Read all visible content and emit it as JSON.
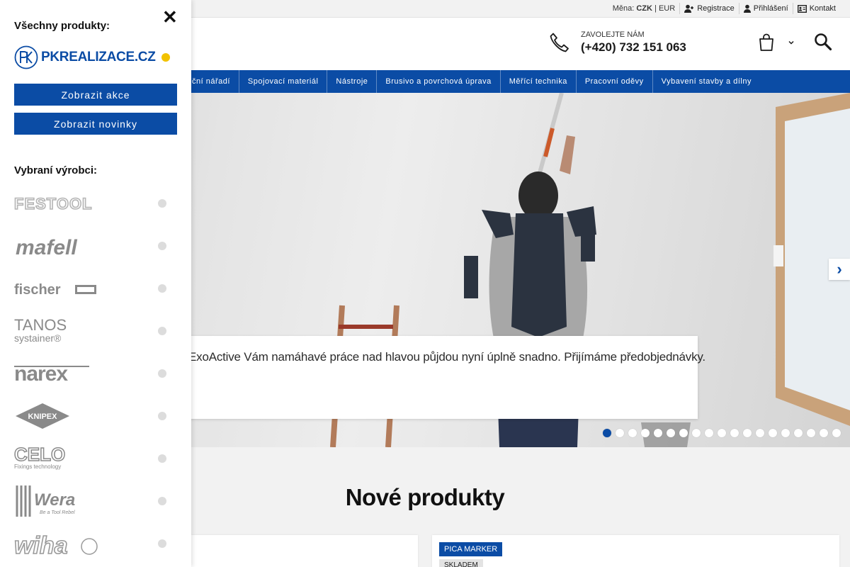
{
  "topbar": {
    "currency_label": "Měna:",
    "currency_active": "CZK",
    "currency_sep": "|",
    "currency_other": "EUR",
    "register_label": "Registrace",
    "login_label": "Přihlášení",
    "contact_label": "Kontakt"
  },
  "header": {
    "phone_caption": "ZAVOLEJTE NÁM",
    "phone_number": "(+420) 732 151 063"
  },
  "nav": {
    "items": [
      "ční nářadí",
      "Spojovací materiál",
      "Nástroje",
      "Brusivo a povrchová úprava",
      "Měřící technika",
      "Pracovní oděvy",
      "Vybavení stavby a dílny"
    ]
  },
  "hero": {
    "caption": "ExoActive Vám namáhavé práce nad hlavou půjdou nyní úplně snadno. Přijímáme předobjednávky.",
    "next_symbol": "›",
    "slide_count": 19,
    "active_slide": 1
  },
  "main": {
    "section_title": "Nové produkty",
    "card_right": {
      "brand_badge": "PICA MARKER",
      "stock_badge": "SKLADEM"
    }
  },
  "sidebar": {
    "title": "Všechny produkty:",
    "close_symbol": "✕",
    "logo_text": "PKREALIZACE.CZ",
    "logo_mark": "PK",
    "btn_akce": "Zobrazit akce",
    "btn_novinky": "Zobrazit novinky",
    "brands_title": "Vybraní výrobci:",
    "brands": [
      {
        "name": "FESTOOL",
        "icon": "festool-logo"
      },
      {
        "name": "mafell",
        "icon": "mafell-logo"
      },
      {
        "name": "fischer",
        "icon": "fischer-logo"
      },
      {
        "name": "TANOS",
        "sub": "systainer®",
        "icon": "tanos-logo"
      },
      {
        "name": "narex",
        "icon": "narex-logo"
      },
      {
        "name": "KNIPEX",
        "icon": "knipex-logo"
      },
      {
        "name": "CELO",
        "sub": "Fixings technology",
        "icon": "celo-logo"
      },
      {
        "name": "Wera",
        "sub": "Be a Tool Rebel",
        "icon": "wera-logo"
      },
      {
        "name": "wiha",
        "icon": "wiha-logo"
      }
    ]
  },
  "colors": {
    "brand_blue": "#0b4ca5",
    "accent_yellow": "#f2c200"
  }
}
